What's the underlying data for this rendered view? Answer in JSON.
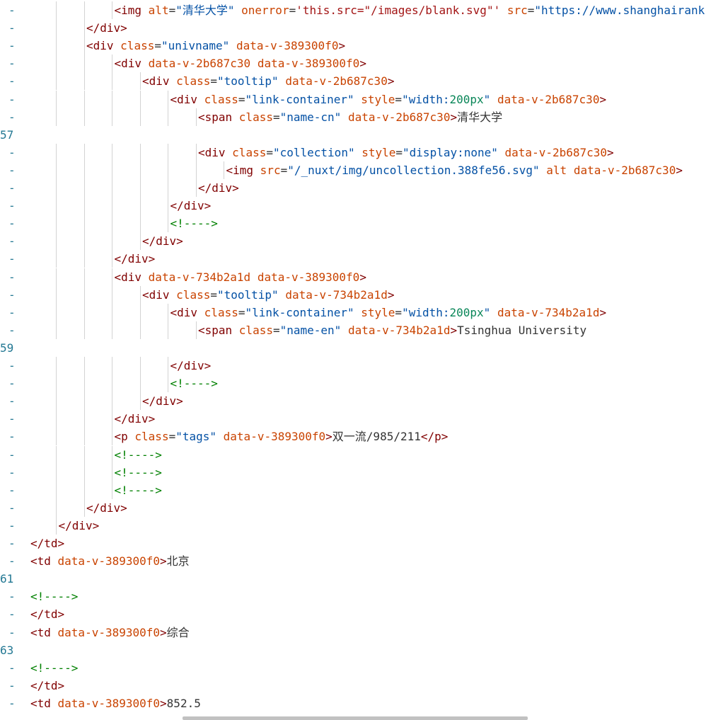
{
  "lines": [
    {
      "gutter": "-",
      "indent": 4,
      "tokens": [
        [
          "tag",
          "<img "
        ],
        [
          "attr-name",
          "alt"
        ],
        [
          "txt",
          "="
        ],
        [
          "val",
          "\"清华大学\""
        ],
        [
          "txt",
          " "
        ],
        [
          "attr-name",
          "onerror"
        ],
        [
          "txt",
          "="
        ],
        [
          "str",
          "'this.src=\"/images/blank.svg\"'"
        ],
        [
          "txt",
          " "
        ],
        [
          "attr-name",
          "src"
        ],
        [
          "txt",
          "="
        ],
        [
          "val",
          "\"https://www.shanghairank"
        ]
      ]
    },
    {
      "gutter": "-",
      "indent": 3,
      "tokens": [
        [
          "tag",
          "</div>"
        ]
      ]
    },
    {
      "gutter": "-",
      "indent": 3,
      "tokens": [
        [
          "tag",
          "<div "
        ],
        [
          "attr-name",
          "class"
        ],
        [
          "txt",
          "="
        ],
        [
          "val",
          "\"univname\""
        ],
        [
          "txt",
          " "
        ],
        [
          "attr-name",
          "data-v-389300f0"
        ],
        [
          "tag",
          ">"
        ]
      ]
    },
    {
      "gutter": "-",
      "indent": 4,
      "tokens": [
        [
          "tag",
          "<div "
        ],
        [
          "attr-name",
          "data-v-2b687c30"
        ],
        [
          "txt",
          " "
        ],
        [
          "attr-name",
          "data-v-389300f0"
        ],
        [
          "tag",
          ">"
        ]
      ]
    },
    {
      "gutter": "-",
      "indent": 5,
      "tokens": [
        [
          "tag",
          "<div "
        ],
        [
          "attr-name",
          "class"
        ],
        [
          "txt",
          "="
        ],
        [
          "val",
          "\"tooltip\""
        ],
        [
          "txt",
          " "
        ],
        [
          "attr-name",
          "data-v-2b687c30"
        ],
        [
          "tag",
          ">"
        ]
      ]
    },
    {
      "gutter": "-",
      "indent": 6,
      "tokens": [
        [
          "tag",
          "<div "
        ],
        [
          "attr-name",
          "class"
        ],
        [
          "txt",
          "="
        ],
        [
          "val",
          "\"link-container\""
        ],
        [
          "txt",
          " "
        ],
        [
          "attr-name",
          "style"
        ],
        [
          "txt",
          "="
        ],
        [
          "val",
          "\"width:"
        ],
        [
          "num",
          "200px"
        ],
        [
          "val",
          "\""
        ],
        [
          "txt",
          " "
        ],
        [
          "attr-name",
          "data-v-2b687c30"
        ],
        [
          "tag",
          ">"
        ]
      ]
    },
    {
      "gutter": "-",
      "indent": 7,
      "tokens": [
        [
          "tag",
          "<span "
        ],
        [
          "attr-name",
          "class"
        ],
        [
          "txt",
          "="
        ],
        [
          "val",
          "\"name-cn\""
        ],
        [
          "txt",
          " "
        ],
        [
          "attr-name",
          "data-v-2b687c30"
        ],
        [
          "tag",
          ">"
        ],
        [
          "txt",
          "清华大学"
        ]
      ]
    },
    {
      "gutter": "57",
      "indent": 0,
      "tokens": []
    },
    {
      "gutter": "-",
      "indent": 7,
      "tokens": [
        [
          "tag",
          "<div "
        ],
        [
          "attr-name",
          "class"
        ],
        [
          "txt",
          "="
        ],
        [
          "val",
          "\"collection\""
        ],
        [
          "txt",
          " "
        ],
        [
          "attr-name",
          "style"
        ],
        [
          "txt",
          "="
        ],
        [
          "val",
          "\"display:none\""
        ],
        [
          "txt",
          " "
        ],
        [
          "attr-name",
          "data-v-2b687c30"
        ],
        [
          "tag",
          ">"
        ]
      ]
    },
    {
      "gutter": "-",
      "indent": 8,
      "tokens": [
        [
          "tag",
          "<img "
        ],
        [
          "attr-name",
          "src"
        ],
        [
          "txt",
          "="
        ],
        [
          "val",
          "\"/_nuxt/img/uncollection.388fe56.svg\""
        ],
        [
          "txt",
          " "
        ],
        [
          "attr-name",
          "alt"
        ],
        [
          "txt",
          " "
        ],
        [
          "attr-name",
          "data-v-2b687c30"
        ],
        [
          "tag",
          ">"
        ]
      ]
    },
    {
      "gutter": "-",
      "indent": 7,
      "tokens": [
        [
          "tag",
          "</div>"
        ]
      ]
    },
    {
      "gutter": "-",
      "indent": 6,
      "tokens": [
        [
          "tag",
          "</div>"
        ]
      ]
    },
    {
      "gutter": "-",
      "indent": 6,
      "tokens": [
        [
          "cmt",
          "<!---->"
        ]
      ]
    },
    {
      "gutter": "-",
      "indent": 5,
      "tokens": [
        [
          "tag",
          "</div>"
        ]
      ]
    },
    {
      "gutter": "-",
      "indent": 4,
      "tokens": [
        [
          "tag",
          "</div>"
        ]
      ]
    },
    {
      "gutter": "-",
      "indent": 4,
      "tokens": [
        [
          "tag",
          "<div "
        ],
        [
          "attr-name",
          "data-v-734b2a1d"
        ],
        [
          "txt",
          " "
        ],
        [
          "attr-name",
          "data-v-389300f0"
        ],
        [
          "tag",
          ">"
        ]
      ]
    },
    {
      "gutter": "-",
      "indent": 5,
      "tokens": [
        [
          "tag",
          "<div "
        ],
        [
          "attr-name",
          "class"
        ],
        [
          "txt",
          "="
        ],
        [
          "val",
          "\"tooltip\""
        ],
        [
          "txt",
          " "
        ],
        [
          "attr-name",
          "data-v-734b2a1d"
        ],
        [
          "tag",
          ">"
        ]
      ]
    },
    {
      "gutter": "-",
      "indent": 6,
      "tokens": [
        [
          "tag",
          "<div "
        ],
        [
          "attr-name",
          "class"
        ],
        [
          "txt",
          "="
        ],
        [
          "val",
          "\"link-container\""
        ],
        [
          "txt",
          " "
        ],
        [
          "attr-name",
          "style"
        ],
        [
          "txt",
          "="
        ],
        [
          "val",
          "\"width:"
        ],
        [
          "num",
          "200px"
        ],
        [
          "val",
          "\""
        ],
        [
          "txt",
          " "
        ],
        [
          "attr-name",
          "data-v-734b2a1d"
        ],
        [
          "tag",
          ">"
        ]
      ]
    },
    {
      "gutter": "-",
      "indent": 7,
      "tokens": [
        [
          "tag",
          "<span "
        ],
        [
          "attr-name",
          "class"
        ],
        [
          "txt",
          "="
        ],
        [
          "val",
          "\"name-en\""
        ],
        [
          "txt",
          " "
        ],
        [
          "attr-name",
          "data-v-734b2a1d"
        ],
        [
          "tag",
          ">"
        ],
        [
          "txt",
          "Tsinghua University"
        ]
      ]
    },
    {
      "gutter": "59",
      "indent": 0,
      "tokens": []
    },
    {
      "gutter": "-",
      "indent": 6,
      "tokens": [
        [
          "tag",
          "</div>"
        ]
      ]
    },
    {
      "gutter": "-",
      "indent": 6,
      "tokens": [
        [
          "cmt",
          "<!---->"
        ]
      ]
    },
    {
      "gutter": "-",
      "indent": 5,
      "tokens": [
        [
          "tag",
          "</div>"
        ]
      ]
    },
    {
      "gutter": "-",
      "indent": 4,
      "tokens": [
        [
          "tag",
          "</div>"
        ]
      ]
    },
    {
      "gutter": "-",
      "indent": 4,
      "tokens": [
        [
          "tag",
          "<p "
        ],
        [
          "attr-name",
          "class"
        ],
        [
          "txt",
          "="
        ],
        [
          "val",
          "\"tags\""
        ],
        [
          "txt",
          " "
        ],
        [
          "attr-name",
          "data-v-389300f0"
        ],
        [
          "tag",
          ">"
        ],
        [
          "txt",
          "双一流/985/211"
        ],
        [
          "tag",
          "</p>"
        ]
      ]
    },
    {
      "gutter": "-",
      "indent": 4,
      "tokens": [
        [
          "cmt",
          "<!---->"
        ]
      ]
    },
    {
      "gutter": "-",
      "indent": 4,
      "tokens": [
        [
          "cmt",
          "<!---->"
        ]
      ]
    },
    {
      "gutter": "-",
      "indent": 4,
      "tokens": [
        [
          "cmt",
          "<!---->"
        ]
      ]
    },
    {
      "gutter": "-",
      "indent": 3,
      "tokens": [
        [
          "tag",
          "</div>"
        ]
      ]
    },
    {
      "gutter": "-",
      "indent": 2,
      "tokens": [
        [
          "tag",
          "</div>"
        ]
      ]
    },
    {
      "gutter": "-",
      "indent": 1,
      "tokens": [
        [
          "tag",
          "</td>"
        ]
      ]
    },
    {
      "gutter": "-",
      "indent": 1,
      "tokens": [
        [
          "tag",
          "<td "
        ],
        [
          "attr-name",
          "data-v-389300f0"
        ],
        [
          "tag",
          ">"
        ],
        [
          "txt",
          "北京"
        ]
      ]
    },
    {
      "gutter": "61",
      "indent": 0,
      "tokens": []
    },
    {
      "gutter": "-",
      "indent": 1,
      "tokens": [
        [
          "cmt",
          "<!---->"
        ]
      ]
    },
    {
      "gutter": "-",
      "indent": 1,
      "tokens": [
        [
          "tag",
          "</td>"
        ]
      ]
    },
    {
      "gutter": "-",
      "indent": 1,
      "tokens": [
        [
          "tag",
          "<td "
        ],
        [
          "attr-name",
          "data-v-389300f0"
        ],
        [
          "tag",
          ">"
        ],
        [
          "txt",
          "综合"
        ]
      ]
    },
    {
      "gutter": "63",
      "indent": 0,
      "tokens": []
    },
    {
      "gutter": "-",
      "indent": 1,
      "tokens": [
        [
          "cmt",
          "<!---->"
        ]
      ]
    },
    {
      "gutter": "-",
      "indent": 1,
      "tokens": [
        [
          "tag",
          "</td>"
        ]
      ]
    },
    {
      "gutter": "-",
      "indent": 1,
      "tokens": [
        [
          "tag",
          "<td "
        ],
        [
          "attr-name",
          "data-v-389300f0"
        ],
        [
          "tag",
          ">"
        ],
        [
          "txt",
          "852.5"
        ]
      ]
    }
  ],
  "colors": {
    "tag": "#800000",
    "attr-name": "#c94300",
    "val": "#0451a5",
    "num": "#098658",
    "str": "#a31515",
    "txt": "#333333",
    "cmt": "#008000",
    "gutter": "#237893"
  }
}
